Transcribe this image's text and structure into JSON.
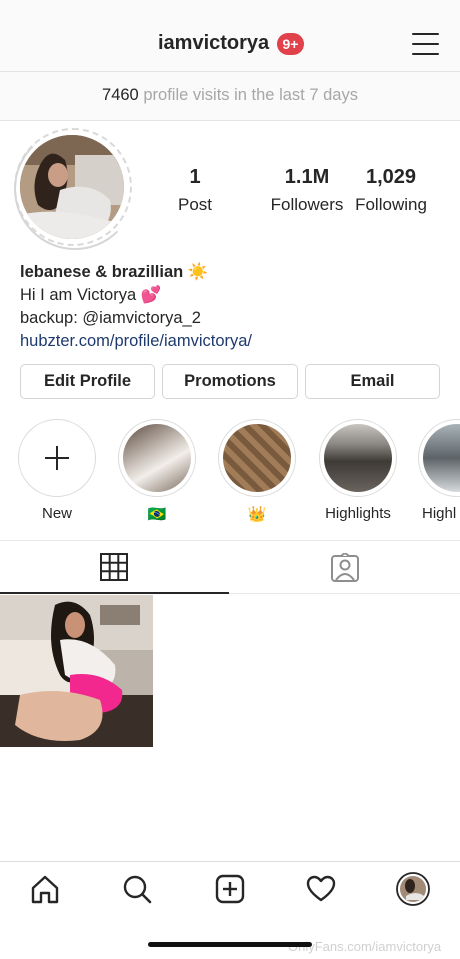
{
  "header": {
    "username": "iamvictorya",
    "notification_badge": "9+"
  },
  "visits": {
    "count": "7460",
    "text": "profile visits in the last 7 days"
  },
  "stats": [
    {
      "value": "1",
      "label": "Post"
    },
    {
      "value": "1.1M",
      "label": "Followers"
    },
    {
      "value": "1,029",
      "label": "Following"
    }
  ],
  "bio": {
    "name": "lebanese & brazillian",
    "name_emoji": "☀️",
    "line1": "Hi I am Victorya",
    "line1_emoji": "💕",
    "line2": "backup: @iamvictorya_2",
    "link": "hubzter.com/profile/iamvictorya/"
  },
  "buttons": {
    "edit_profile": "Edit Profile",
    "promotions": "Promotions",
    "email": "Email"
  },
  "highlights": [
    {
      "label": "New"
    },
    {
      "label": "🇧🇷"
    },
    {
      "label": "👑"
    },
    {
      "label": "Highlights"
    },
    {
      "label": "Highl"
    }
  ],
  "watermark": "OnlyFans.com/iamvictorya",
  "colors": {
    "badge": "#e0414b",
    "link": "#1e3a6e",
    "muted_text": "#a7a7a7"
  }
}
